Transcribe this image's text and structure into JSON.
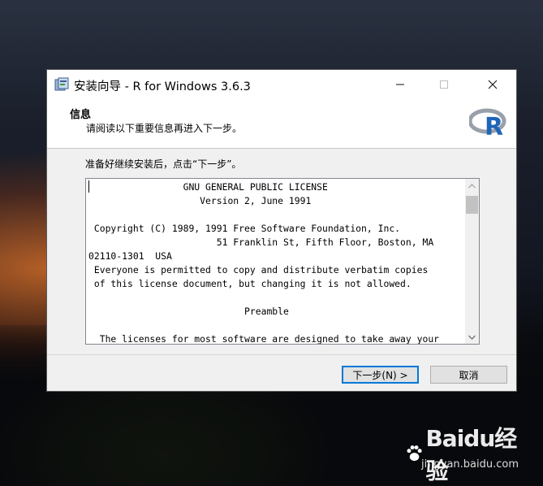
{
  "window": {
    "title": "安装向导 - R for Windows 3.6.3"
  },
  "header": {
    "title": "信息",
    "subtitle": "请阅读以下重要信息再进入下一步。",
    "logo_letter": "R"
  },
  "instruction": "准备好继续安装后，点击“下一步”。",
  "license_lines": [
    "                 GNU GENERAL PUBLIC LICENSE",
    "                    Version 2, June 1991",
    "",
    " Copyright (C) 1989, 1991 Free Software Foundation, Inc.",
    "                       51 Franklin St, Fifth Floor, Boston, MA",
    "02110-1301  USA",
    " Everyone is permitted to copy and distribute verbatim copies",
    " of this license document, but changing it is not allowed.",
    "",
    "                            Preamble",
    "",
    "  The licenses for most software are designed to take away your"
  ],
  "buttons": {
    "next": "下一步(N) >",
    "cancel": "取消"
  },
  "watermark": {
    "brand": "Baidu经验",
    "url": "jingyan.baidu.com"
  },
  "colors": {
    "dialog_bg": "#f0f0f0",
    "focus_border": "#0078d7",
    "r_logo_blue": "#1f65b7",
    "r_logo_gray": "#9aa0aa"
  }
}
